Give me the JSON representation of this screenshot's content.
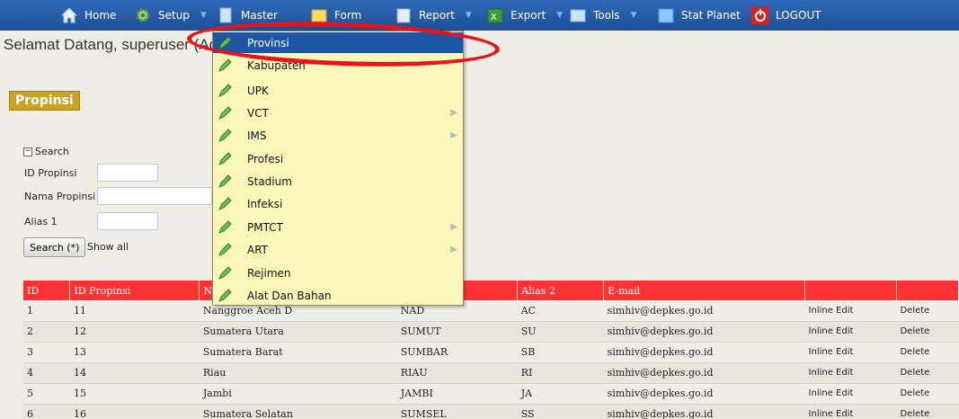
{
  "nav": {
    "home": "Home",
    "setup": "Setup",
    "master": "Master",
    "form": "Form",
    "report": "Report",
    "export": "Export",
    "tools": "Tools",
    "statplanet": "Stat Planet",
    "logout": "LOGOUT"
  },
  "welcome": "Selamat Datang, superuser (Adr",
  "page_title": "Propinsi",
  "search": {
    "toggle": "Search",
    "id_label": "ID Propinsi",
    "nama_label": "Nama Propinsi",
    "alias_label": "Alias 1",
    "button": "Search (*)",
    "show_all": "Show all"
  },
  "menu": {
    "items": [
      {
        "label": "Provinsi",
        "submenu": false
      },
      {
        "label": "Kabupaten",
        "submenu": false
      },
      {
        "label": "UPK",
        "submenu": false
      },
      {
        "label": "VCT",
        "submenu": true
      },
      {
        "label": "IMS",
        "submenu": true
      },
      {
        "label": "Profesi",
        "submenu": false
      },
      {
        "label": "Stadium",
        "submenu": false
      },
      {
        "label": "Infeksi",
        "submenu": false
      },
      {
        "label": "PMTCT",
        "submenu": true
      },
      {
        "label": "ART",
        "submenu": true
      },
      {
        "label": "Rejimen",
        "submenu": false
      },
      {
        "label": "Alat Dan Bahan",
        "submenu": false
      }
    ]
  },
  "table": {
    "headers": [
      "ID",
      "ID Propinsi",
      "Na",
      "",
      "Alias 2",
      "E-mail",
      "",
      ""
    ],
    "rows": [
      [
        "1",
        "11",
        "Nanggroe Aceh D",
        "NAD",
        "AC",
        "simhiv@depkes.go.id",
        "Inline Edit",
        "Delete"
      ],
      [
        "2",
        "12",
        "Sumatera Utara",
        "SUMUT",
        "SU",
        "simhiv@depkes.go.id",
        "Inline Edit",
        "Delete"
      ],
      [
        "3",
        "13",
        "Sumatera Barat",
        "SUMBAR",
        "SB",
        "simhiv@depkes.go.id",
        "Inline Edit",
        "Delete"
      ],
      [
        "4",
        "14",
        "Riau",
        "RIAU",
        "RI",
        "simhiv@depkes.go.id",
        "Inline Edit",
        "Delete"
      ],
      [
        "5",
        "15",
        "Jambi",
        "JAMBI",
        "JA",
        "simhiv@depkes.go.id",
        "Inline Edit",
        "Delete"
      ],
      [
        "6",
        "16",
        "Sumatera Selatan",
        "SUMSEL",
        "SS",
        "simhiv@depkes.go.id",
        "Inline Edit",
        "Delete"
      ]
    ]
  },
  "colors": {
    "navbar": "#1f56a3",
    "table_header": "#ff3333",
    "menu_bg": "#fbf7b8",
    "title_bg": "#c9a323",
    "annotation": "#e8141c"
  }
}
